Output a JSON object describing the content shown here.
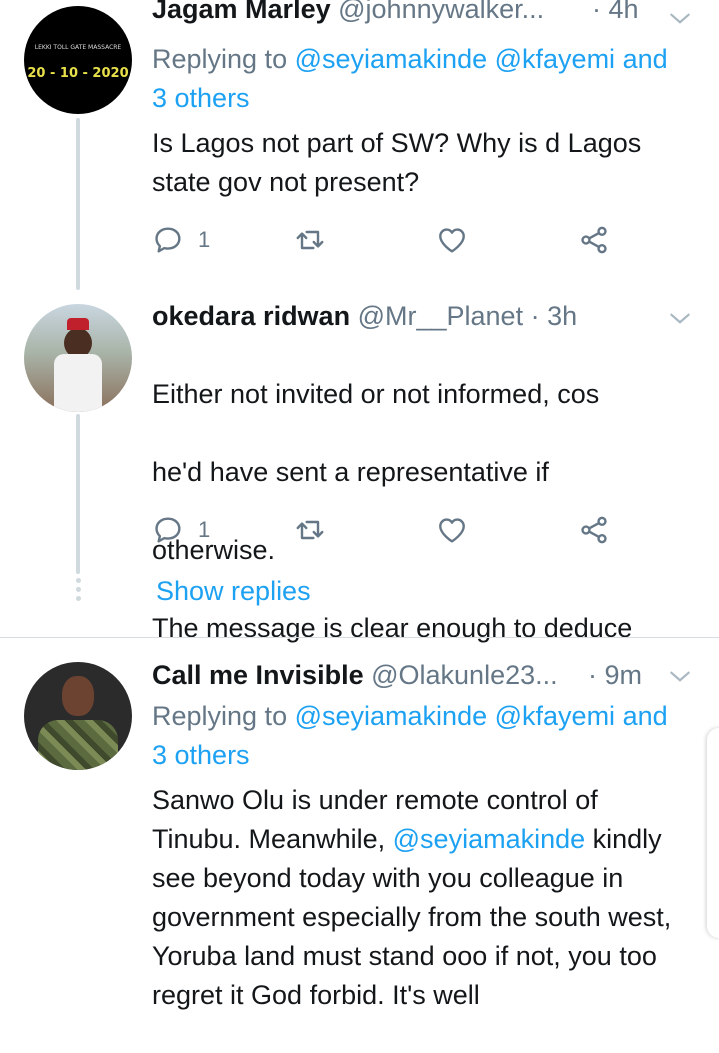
{
  "tweets": [
    {
      "name": "Jagam Marley",
      "handle": "@johnnywalker...",
      "time": "4h",
      "avatar_banner": "LEKKI TOLL GATE MASSACRE",
      "avatar_date": "20 - 10 - 2020",
      "reply_label": "Replying to",
      "reply_mentions": [
        "@seyiamakinde",
        "@kfayemi"
      ],
      "reply_others": "and 3 others",
      "text": "Is Lagos not part of SW? Why is d Lagos state gov not present?",
      "reply_count": "1"
    },
    {
      "name": "okedara ridwan",
      "handle": "@Mr__Planet",
      "time": "3h",
      "text_lines": [
        "Either not invited or not informed, cos",
        "he'd have sent a representative if",
        "otherwise.",
        "The message is clear enough to deduce"
      ],
      "reply_count": "1",
      "show_replies": "Show replies"
    },
    {
      "name": "Call me Invisible",
      "handle": "@Olakunle23...",
      "time": "9m",
      "reply_label": "Replying to",
      "reply_mentions": [
        "@seyiamakinde",
        "@kfayemi"
      ],
      "reply_others": "and 3 others",
      "text_part1": "Sanwo Olu is under remote control of Tinubu. Meanwhile, ",
      "text_mention": "@seyiamakinde",
      "text_part2": " kindly see beyond today with you colleague in government especially from the south west, Yoruba land must stand ooo if not, you too regret it God forbid. It's well"
    }
  ],
  "separator": "·",
  "colors": {
    "accent": "#1da1f2",
    "secondary": "#657786",
    "text": "#14171a",
    "line": "#cfd9de"
  }
}
